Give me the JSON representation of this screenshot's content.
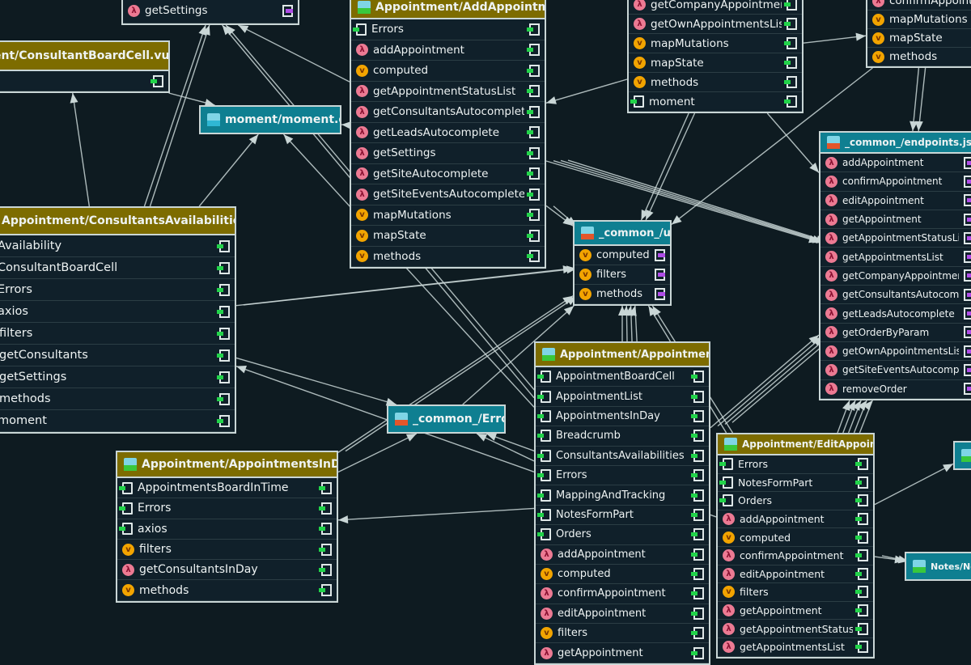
{
  "colors": {
    "background": "#0e1b21",
    "vue_header": "#7d6c00",
    "js_header": "#0f7f91",
    "edge": "#c9d6d6",
    "lambda_icon": "#ec7a93",
    "var_icon": "#f2a400",
    "import_icon": "#22d34a",
    "export_icon": "#b04ee8"
  },
  "nodes": [
    {
      "id": "n-settings",
      "kind": "vue",
      "title": "",
      "export": "purple",
      "rows": [
        {
          "icon": "lambda",
          "label": "getSettings"
        }
      ]
    },
    {
      "id": "n-cbc",
      "kind": "vue",
      "file": "vue",
      "title": "ent/ConsultantBoardCell.vue",
      "export": "green",
      "rows": [
        {
          "icon": "none",
          "label": ""
        }
      ]
    },
    {
      "id": "n-moment",
      "kind": "js",
      "file": "ts",
      "title": "moment/moment.d.ts",
      "rows": []
    },
    {
      "id": "n-add",
      "kind": "vue",
      "file": "vue",
      "title": "Appointment/AddAppointment.vue",
      "export": "green",
      "rows": [
        {
          "icon": "imp",
          "label": "Errors"
        },
        {
          "icon": "lambda",
          "label": "addAppointment"
        },
        {
          "icon": "v",
          "label": "computed"
        },
        {
          "icon": "lambda",
          "label": "getAppointmentStatusList"
        },
        {
          "icon": "lambda",
          "label": "getConsultantsAutocomplete"
        },
        {
          "icon": "lambda",
          "label": "getLeadsAutocomplete"
        },
        {
          "icon": "lambda",
          "label": "getSettings"
        },
        {
          "icon": "lambda",
          "label": "getSiteAutocomplete"
        },
        {
          "icon": "lambda",
          "label": "getSiteEventsAutocomplete"
        },
        {
          "icon": "v",
          "label": "mapMutations"
        },
        {
          "icon": "v",
          "label": "mapState"
        },
        {
          "icon": "v",
          "label": "methods"
        }
      ]
    },
    {
      "id": "n-company",
      "kind": "vue",
      "title": "",
      "export": "green",
      "rows": [
        {
          "icon": "lambda",
          "label": "getCompanyAppointmentsList"
        },
        {
          "icon": "lambda",
          "label": "getOwnAppointmentsList"
        },
        {
          "icon": "v",
          "label": "mapMutations"
        },
        {
          "icon": "v",
          "label": "mapState"
        },
        {
          "icon": "v",
          "label": "methods"
        },
        {
          "icon": "imp",
          "label": "moment"
        }
      ]
    },
    {
      "id": "n-topright",
      "kind": "vue",
      "title": "",
      "export": "none",
      "rows": [
        {
          "icon": "lambda",
          "label": "confirmAppointment"
        },
        {
          "icon": "v",
          "label": "mapMutations"
        },
        {
          "icon": "v",
          "label": "mapState"
        },
        {
          "icon": "v",
          "label": "methods"
        }
      ]
    },
    {
      "id": "n-endpoints",
      "kind": "js",
      "file": "js",
      "title": "_common_/endpoints.js",
      "export": "purple",
      "rows": [
        {
          "icon": "lambda",
          "label": "addAppointment"
        },
        {
          "icon": "lambda",
          "label": "confirmAppointment"
        },
        {
          "icon": "lambda",
          "label": "editAppointment"
        },
        {
          "icon": "lambda",
          "label": "getAppointment"
        },
        {
          "icon": "lambda",
          "label": "getAppointmentStatusList"
        },
        {
          "icon": "lambda",
          "label": "getAppointmentsList"
        },
        {
          "icon": "lambda",
          "label": "getCompanyAppointmentsList"
        },
        {
          "icon": "lambda",
          "label": "getConsultantsAutocomplete"
        },
        {
          "icon": "lambda",
          "label": "getLeadsAutocomplete"
        },
        {
          "icon": "lambda",
          "label": "getOrderByParam"
        },
        {
          "icon": "lambda",
          "label": "getOwnAppointmentsList"
        },
        {
          "icon": "lambda",
          "label": "getSiteEventsAutocomplete"
        },
        {
          "icon": "lambda",
          "label": "removeOrder"
        }
      ]
    },
    {
      "id": "n-util",
      "kind": "js",
      "file": "js",
      "title": "_common_/util.js",
      "export": "purple",
      "rows": [
        {
          "icon": "v",
          "label": "computed"
        },
        {
          "icon": "v",
          "label": "filters"
        },
        {
          "icon": "v",
          "label": "methods"
        }
      ]
    },
    {
      "id": "n-avail",
      "kind": "vue",
      "file": "vue",
      "title": "Appointment/ConsultantsAvailabilities.vue",
      "export": "green",
      "rows": [
        {
          "icon": "imp",
          "label": "Availability"
        },
        {
          "icon": "imp",
          "label": "ConsultantBoardCell"
        },
        {
          "icon": "imp",
          "label": "Errors"
        },
        {
          "icon": "imp",
          "label": "axios"
        },
        {
          "icon": "v",
          "label": "filters"
        },
        {
          "icon": "lambda",
          "label": "getConsultants"
        },
        {
          "icon": "lambda",
          "label": "getSettings"
        },
        {
          "icon": "v",
          "label": "methods"
        },
        {
          "icon": "imp",
          "label": "moment"
        }
      ]
    },
    {
      "id": "n-errors",
      "kind": "js",
      "file": "js",
      "title": "_common_/Errors.js",
      "rows": []
    },
    {
      "id": "n-inday",
      "kind": "vue",
      "file": "vue",
      "title": "Appointment/AppointmentsInDay.vue",
      "export": "green",
      "rows": [
        {
          "icon": "imp",
          "label": "AppointmentsBoardInTime"
        },
        {
          "icon": "imp",
          "label": "Errors"
        },
        {
          "icon": "imp",
          "label": "axios"
        },
        {
          "icon": "v",
          "label": "filters"
        },
        {
          "icon": "lambda",
          "label": "getConsultantsInDay"
        },
        {
          "icon": "v",
          "label": "methods"
        }
      ]
    },
    {
      "id": "n-appt",
      "kind": "vue",
      "file": "vue",
      "title": "Appointment/Appointment.vue",
      "export": "green",
      "rows": [
        {
          "icon": "imp",
          "label": "AppointmentBoardCell"
        },
        {
          "icon": "imp",
          "label": "AppointmentList"
        },
        {
          "icon": "imp",
          "label": "AppointmentsInDay"
        },
        {
          "icon": "imp",
          "label": "Breadcrumb"
        },
        {
          "icon": "imp",
          "label": "ConsultantsAvailabilities"
        },
        {
          "icon": "imp",
          "label": "Errors"
        },
        {
          "icon": "imp",
          "label": "MappingAndTracking"
        },
        {
          "icon": "imp",
          "label": "NotesFormPart"
        },
        {
          "icon": "imp",
          "label": "Orders"
        },
        {
          "icon": "lambda",
          "label": "addAppointment"
        },
        {
          "icon": "v",
          "label": "computed"
        },
        {
          "icon": "lambda",
          "label": "confirmAppointment"
        },
        {
          "icon": "lambda",
          "label": "editAppointment"
        },
        {
          "icon": "v",
          "label": "filters"
        },
        {
          "icon": "lambda",
          "label": "getAppointment"
        }
      ]
    },
    {
      "id": "n-edit",
      "kind": "vue",
      "file": "vue",
      "title": "Appointment/EditAppointment.vue",
      "export": "green",
      "rows": [
        {
          "icon": "imp",
          "label": "Errors"
        },
        {
          "icon": "imp",
          "label": "NotesFormPart"
        },
        {
          "icon": "imp",
          "label": "Orders"
        },
        {
          "icon": "lambda",
          "label": "addAppointment"
        },
        {
          "icon": "v",
          "label": "computed"
        },
        {
          "icon": "lambda",
          "label": "confirmAppointment"
        },
        {
          "icon": "lambda",
          "label": "editAppointment"
        },
        {
          "icon": "v",
          "label": "filters"
        },
        {
          "icon": "lambda",
          "label": "getAppointment"
        },
        {
          "icon": "lambda",
          "label": "getAppointmentStatusList"
        },
        {
          "icon": "lambda",
          "label": "getAppointmentsList"
        }
      ]
    },
    {
      "id": "n-notes",
      "kind": "js",
      "file": "vue",
      "title": "Notes/NotesFo",
      "rows": []
    },
    {
      "id": "n-small",
      "kind": "js",
      "file": "vue",
      "title": "",
      "rows": []
    }
  ],
  "edges": [
    [
      "n-cbc",
      "n-moment"
    ],
    [
      "n-avail",
      "n-cbc"
    ],
    [
      "n-avail",
      "n-settings"
    ],
    [
      "n-avail",
      "n-settings"
    ],
    [
      "n-avail",
      "n-moment"
    ],
    [
      "n-add",
      "n-moment"
    ],
    [
      "n-add",
      "n-settings"
    ],
    [
      "n-appt",
      "n-settings"
    ],
    [
      "n-appt",
      "n-moment"
    ],
    [
      "n-appt",
      "n-settings"
    ],
    [
      "n-add",
      "n-util"
    ],
    [
      "n-add",
      "n-util"
    ],
    [
      "n-add",
      "n-endpoints"
    ],
    [
      "n-add",
      "n-endpoints"
    ],
    [
      "n-add",
      "n-endpoints"
    ],
    [
      "n-add",
      "n-endpoints"
    ],
    [
      "n-company",
      "n-add"
    ],
    [
      "n-company",
      "n-util"
    ],
    [
      "n-company",
      "n-util"
    ],
    [
      "n-company",
      "n-endpoints"
    ],
    [
      "n-company",
      "n-topright"
    ],
    [
      "n-topright",
      "n-endpoints"
    ],
    [
      "n-topright",
      "n-util"
    ],
    [
      "n-topright",
      "n-endpoints"
    ],
    [
      "n-avail",
      "n-util"
    ],
    [
      "n-avail",
      "n-util"
    ],
    [
      "n-avail",
      "n-errors"
    ],
    [
      "n-inday",
      "n-errors"
    ],
    [
      "n-inday",
      "n-util"
    ],
    [
      "n-inday",
      "n-util"
    ],
    [
      "n-appt",
      "n-util"
    ],
    [
      "n-appt",
      "n-util"
    ],
    [
      "n-appt",
      "n-util"
    ],
    [
      "n-appt",
      "n-util"
    ],
    [
      "n-appt",
      "n-errors"
    ],
    [
      "n-appt",
      "n-inday"
    ],
    [
      "n-appt",
      "n-avail"
    ],
    [
      "n-edit",
      "n-util"
    ],
    [
      "n-edit",
      "n-util"
    ],
    [
      "n-edit",
      "n-errors"
    ],
    [
      "n-edit",
      "n-endpoints"
    ],
    [
      "n-edit",
      "n-endpoints"
    ],
    [
      "n-edit",
      "n-endpoints"
    ],
    [
      "n-edit",
      "n-endpoints"
    ],
    [
      "n-edit",
      "n-endpoints"
    ],
    [
      "n-edit",
      "n-notes"
    ],
    [
      "n-edit",
      "n-notes"
    ],
    [
      "n-edit",
      "n-small"
    ],
    [
      "n-appt",
      "n-endpoints"
    ],
    [
      "n-appt",
      "n-endpoints"
    ],
    [
      "n-appt",
      "n-endpoints"
    ],
    [
      "n-appt",
      "n-endpoints"
    ],
    [
      "n-errors",
      "n-util"
    ]
  ]
}
